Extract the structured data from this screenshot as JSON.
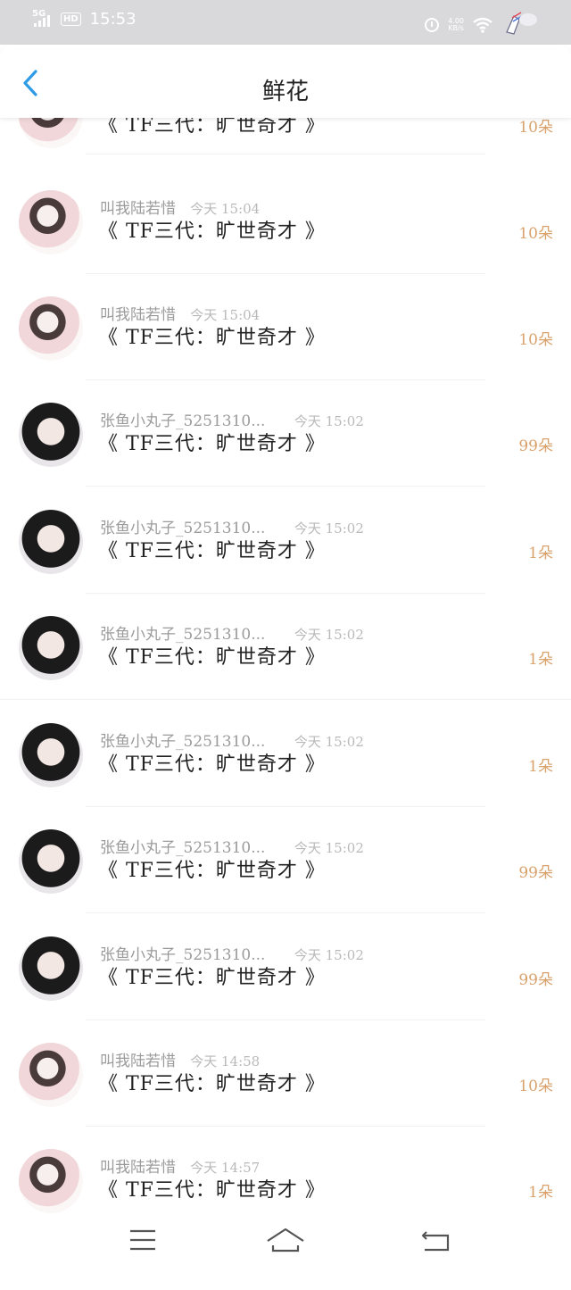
{
  "status": {
    "network": "5G",
    "hd": "HD",
    "time": "15:53",
    "speed_top": "4.00",
    "speed_unit": "KB/s"
  },
  "header": {
    "title": "鲜花",
    "back_icon": "back-chevron-icon"
  },
  "entries": [
    {
      "user": "",
      "time": "",
      "book": "《 TF三代：旷世奇才 》",
      "amount": "10朵",
      "avatar": "anime"
    },
    {
      "user": "叫我陆若惜",
      "time": "今天 15:04",
      "book": "《 TF三代：旷世奇才 》",
      "amount": "10朵",
      "avatar": "anime"
    },
    {
      "user": "叫我陆若惜",
      "time": "今天 15:04",
      "book": "《 TF三代：旷世奇才 》",
      "amount": "10朵",
      "avatar": "anime"
    },
    {
      "user": "张鱼小丸子_5251310...",
      "time": "今天 15:02",
      "book": "《 TF三代：旷世奇才 》",
      "amount": "99朵",
      "avatar": "girl"
    },
    {
      "user": "张鱼小丸子_5251310...",
      "time": "今天 15:02",
      "book": "《 TF三代：旷世奇才 》",
      "amount": "1朵",
      "avatar": "girl"
    },
    {
      "user": "张鱼小丸子_5251310...",
      "time": "今天 15:02",
      "book": "《 TF三代：旷世奇才 》",
      "amount": "1朵",
      "avatar": "girl"
    },
    {
      "user": "张鱼小丸子_5251310...",
      "time": "今天 15:02",
      "book": "《 TF三代：旷世奇才 》",
      "amount": "1朵",
      "avatar": "girl"
    },
    {
      "user": "张鱼小丸子_5251310...",
      "time": "今天 15:02",
      "book": "《 TF三代：旷世奇才 》",
      "amount": "99朵",
      "avatar": "girl"
    },
    {
      "user": "张鱼小丸子_5251310...",
      "time": "今天 15:02",
      "book": "《 TF三代：旷世奇才 》",
      "amount": "99朵",
      "avatar": "girl"
    },
    {
      "user": "叫我陆若惜",
      "time": "今天 14:58",
      "book": "《 TF三代：旷世奇才 》",
      "amount": "10朵",
      "avatar": "anime"
    },
    {
      "user": "叫我陆若惜",
      "time": "今天 14:57",
      "book": "《 TF三代：旷世奇才 》",
      "amount": "1朵",
      "avatar": "anime"
    }
  ],
  "colors": {
    "accent": "#2e9be6",
    "amount": "#d9a16b",
    "statusbar": "#d9d9db"
  },
  "bottom_nav": {
    "menu_icon": "menu-icon",
    "home_icon": "home-icon",
    "back_icon": "return-icon"
  }
}
